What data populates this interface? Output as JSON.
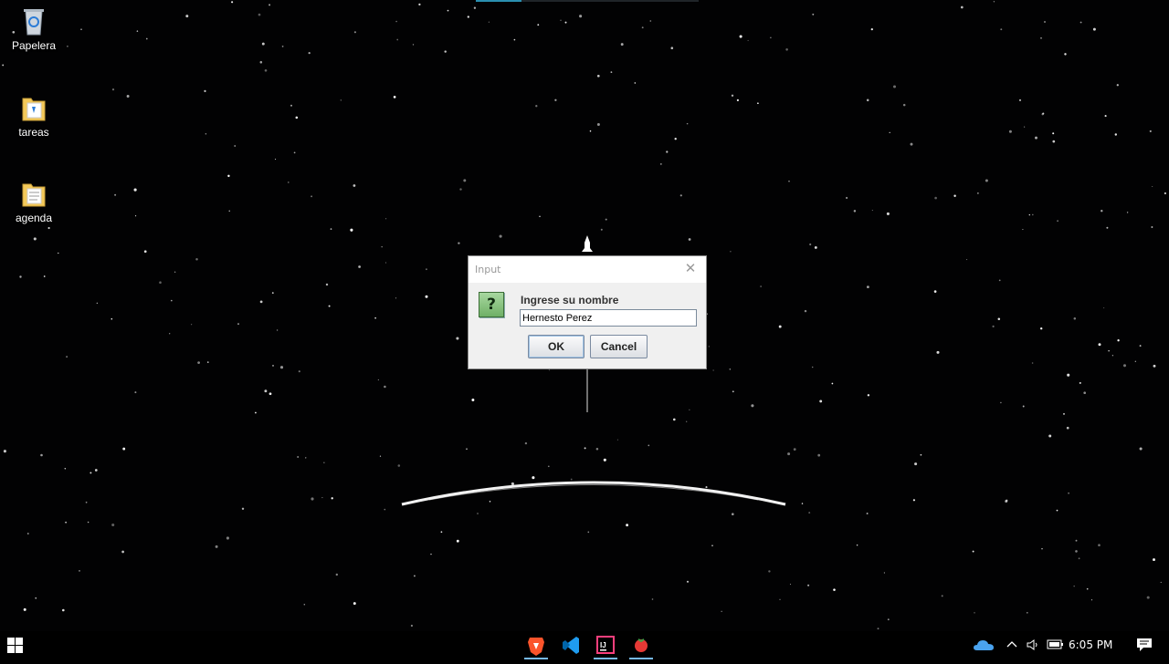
{
  "desktop": {
    "icons": [
      {
        "label": "Papelera",
        "icon": "recycle-bin-icon"
      },
      {
        "label": "tareas",
        "icon": "folder-icon"
      },
      {
        "label": "agenda",
        "icon": "folder-icon"
      }
    ],
    "wallpaper": "space-shuttle-starfield"
  },
  "dialog": {
    "title": "Input",
    "message": "Ingrese su nombre",
    "input_value": "Hernesto Perez",
    "ok_label": "OK",
    "cancel_label": "Cancel",
    "icon": "question-icon"
  },
  "taskbar": {
    "apps": [
      "brave-browser-icon",
      "vscode-icon",
      "intellij-icon",
      "tomato-timer-icon"
    ],
    "tray": [
      "onedrive-icon",
      "chevron-up-icon",
      "volume-icon",
      "battery-icon"
    ],
    "clock": "6:05 PM"
  },
  "colors": {
    "accent": "#76b9ed",
    "dialog_bg": "#f0f0f0"
  }
}
